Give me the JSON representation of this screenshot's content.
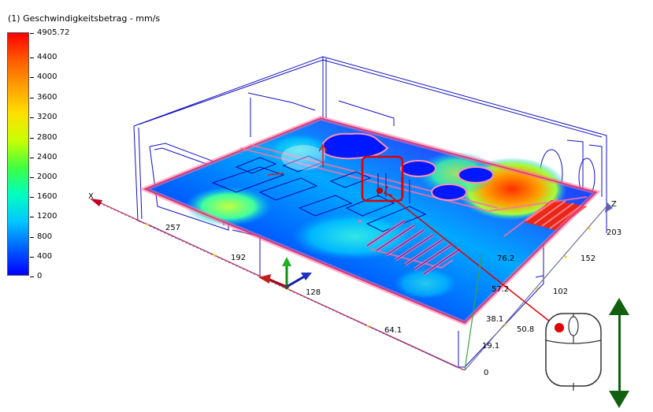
{
  "legend": {
    "title": "(1) Geschwindigkeitsbetrag - mm/s",
    "ticks": [
      "4905.72",
      "4400",
      "4000",
      "3600",
      "3200",
      "2800",
      "2400",
      "2000",
      "1600",
      "1200",
      "800",
      "400",
      "0"
    ],
    "colors": [
      "#ff0000",
      "#ff5a00",
      "#ffa000",
      "#ffe000",
      "#c8ff00",
      "#40ff40",
      "#00ffc0",
      "#00c8ff",
      "#0060ff",
      "#0000ff"
    ]
  },
  "axes": {
    "x_label": "X",
    "z_label": "Z",
    "x_ticks": [
      "257",
      "192",
      "128",
      "64.1"
    ],
    "z_ticks": [
      "203",
      "152",
      "102",
      "50.8",
      "0"
    ],
    "y_ticks": [
      "76.2",
      "57.2",
      "38.1",
      "19.1"
    ]
  },
  "icons": {
    "mouse": "mouse-icon",
    "scroll": "vertical-double-arrow-icon",
    "triad": "coordinate-triad-icon"
  }
}
